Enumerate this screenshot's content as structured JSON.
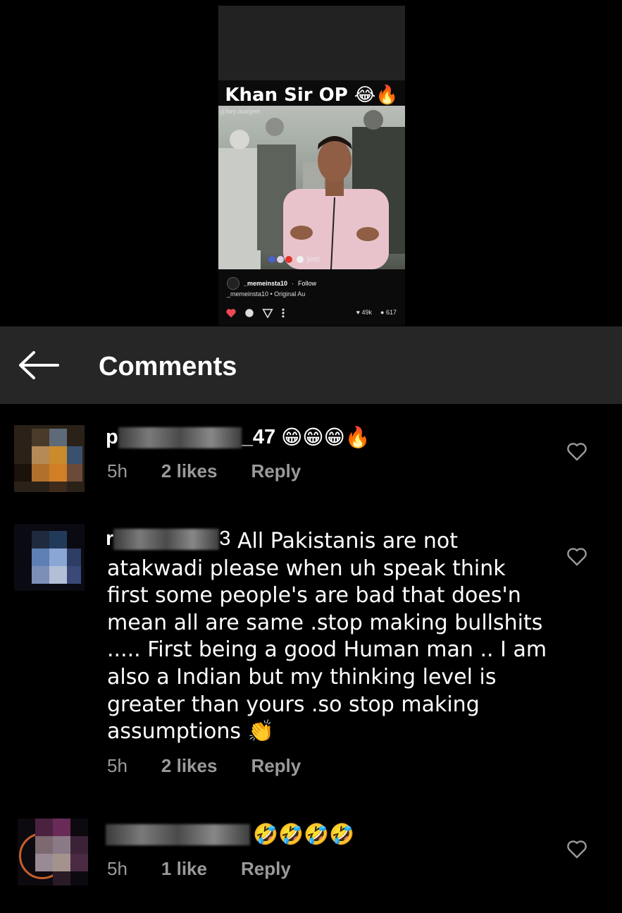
{
  "reel": {
    "title": "Khan Sir OP 😂🔥",
    "watermark": "@hey.manjeet",
    "overlay_text": "jeet",
    "account": "_memeinsta10",
    "follow_label": "Follow",
    "audio": "_memeinsta10 • Original Au",
    "likes": "49k",
    "comments": "617"
  },
  "header": {
    "title": "Comments"
  },
  "comments": [
    {
      "username_suffix": "_47",
      "username_emojis": "😁😁😁🔥",
      "text": "",
      "time": "5h",
      "likes": "2 likes",
      "reply": "Reply"
    },
    {
      "username_suffix": "3",
      "text": "All Pakistanis are not atakwadi  please when uh speak think first some people's are bad that does'n mean all are same .stop making bullshits ..... First being a good Human man .. I am also a Indian but my thinking level is greater than yours .so stop making assumptions 👏",
      "time": "5h",
      "likes": "2 likes",
      "reply": "Reply"
    },
    {
      "username_suffix": "",
      "username_emojis": "🤣🤣🤣🤣",
      "text": "",
      "time": "5h",
      "likes": "1 like",
      "reply": "Reply"
    }
  ],
  "colors": {
    "background": "#000000",
    "header_bg": "#262626",
    "meta_gray": "#9a9a9a",
    "like_red": "#ed4956"
  }
}
